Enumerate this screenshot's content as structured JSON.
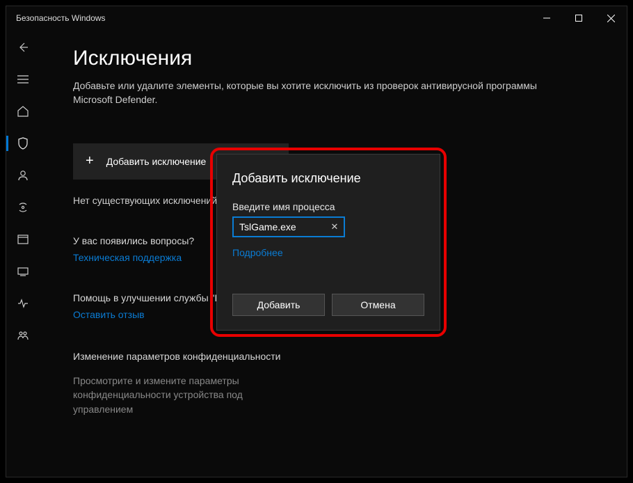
{
  "titlebar": {
    "title": "Безопасность Windows"
  },
  "page": {
    "heading": "Исключения",
    "description": "Добавьте или удалите элементы, которые вы хотите исключить из проверок антивирусной программы Microsoft Defender.",
    "add_button": "Добавить исключение",
    "no_exclusions": "Нет существующих исключений.",
    "questions_title": "У вас появились вопросы?",
    "support_link": "Техническая поддержка",
    "help_title": "Помощь в улучшении службы \"Безопасность Windows\"",
    "feedback_link": "Оставить отзыв",
    "privacy_title": "Изменение параметров конфиденциальности",
    "privacy_desc": "Просмотрите и измените параметры конфиденциальности устройства под управлением"
  },
  "dialog": {
    "title": "Добавить исключение",
    "label": "Введите имя процесса",
    "input_value": "TslGame.exe",
    "more_link": "Подробнее",
    "add": "Добавить",
    "cancel": "Отмена"
  }
}
